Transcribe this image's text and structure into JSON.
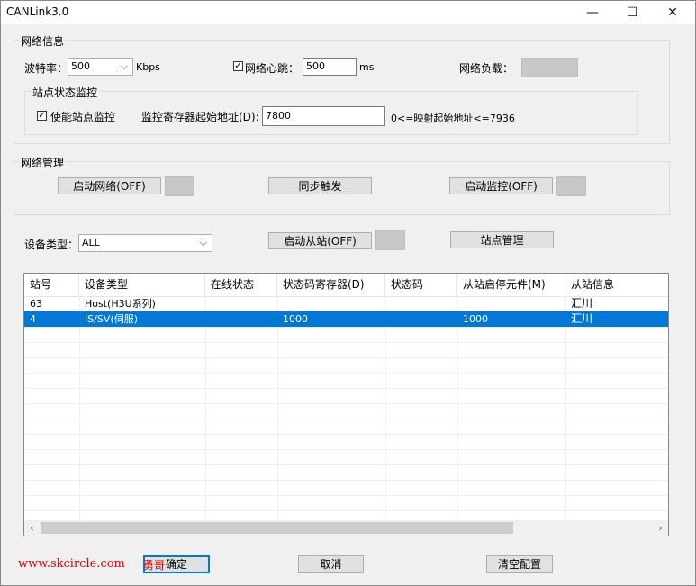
{
  "window": {
    "title": "CANLink3.0",
    "minimize": "—",
    "maximize": "☐",
    "close": "✕"
  },
  "network_info": {
    "title": "网络信息",
    "baud_label": "波特率：",
    "baud_value": "500",
    "baud_unit": "Kbps",
    "heartbeat_checked": true,
    "heartbeat_label": "网络心跳：",
    "heartbeat_value": "500",
    "heartbeat_unit": "ms",
    "load_label": "网络负载："
  },
  "station_monitor": {
    "title": "站点状态监控",
    "enable_checked": true,
    "enable_label": "使能站点监控",
    "addr_label": "监控寄存器起始地址(D):",
    "addr_value": "7800",
    "addr_hint": "0<=映射起始地址<=7936"
  },
  "network_mgmt": {
    "title": "网络管理",
    "start_network": "启动网络(OFF)",
    "sync_trigger": "同步触发",
    "start_monitor": "启动监控(OFF)"
  },
  "device": {
    "type_label": "设备类型：",
    "type_value": "ALL",
    "start_slave": "启动从站(OFF)",
    "station_mgmt": "站点管理"
  },
  "table": {
    "columns": [
      "站号",
      "设备类型",
      "在线状态",
      "状态码寄存器(D)",
      "状态码",
      "从站启停元件(M)",
      "从站信息"
    ],
    "rows": [
      [
        "63",
        "Host(H3U系列)",
        "",
        "",
        "",
        "",
        "汇川"
      ],
      [
        "4",
        "IS/SV(伺服)",
        "",
        "1000",
        "",
        "1000",
        "汇川"
      ]
    ],
    "selected_row": 1,
    "scroll_left": "‹",
    "scroll_right": "›"
  },
  "footer": {
    "ok": "确定",
    "cancel": "取消",
    "clear": "清空配置"
  },
  "watermark": {
    "url": "www.skcircle.com",
    "tag": "勇哥"
  },
  "colors": {
    "selection": "#0078d7",
    "focus_border": "#0078d7",
    "watermark": "#dd0000"
  }
}
